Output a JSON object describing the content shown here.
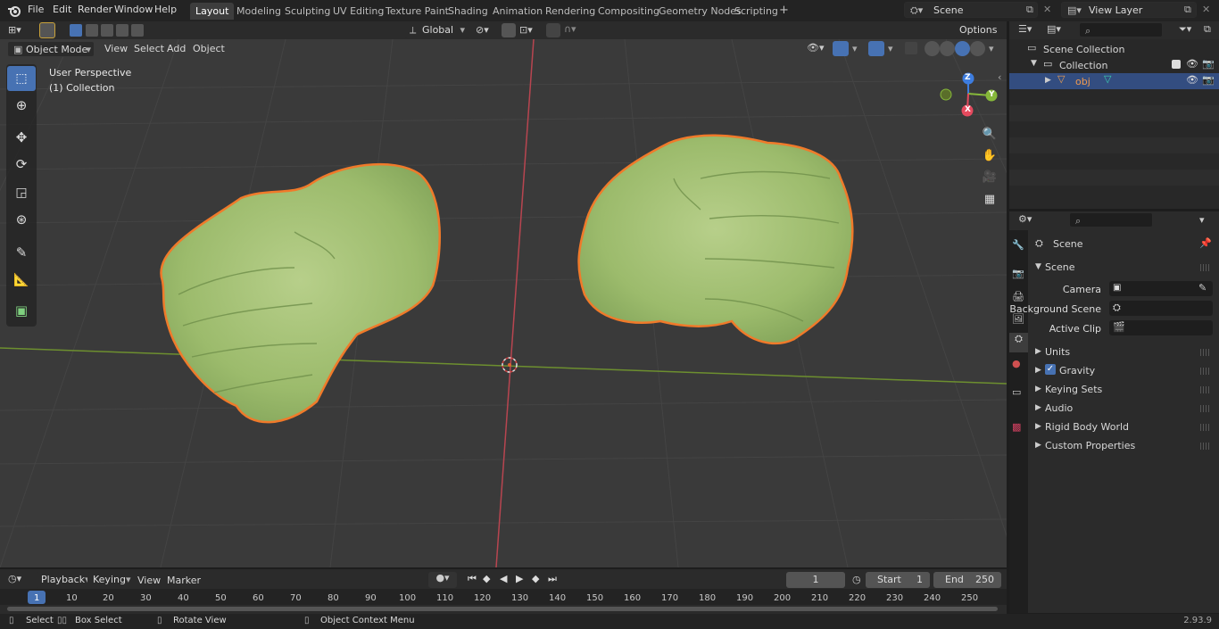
{
  "menus": [
    "File",
    "Edit",
    "Render",
    "Window",
    "Help"
  ],
  "workspaces": [
    "Layout",
    "Modeling",
    "Sculpting",
    "UV Editing",
    "Texture Paint",
    "Shading",
    "Animation",
    "Rendering",
    "Compositing",
    "Geometry Nodes",
    "Scripting"
  ],
  "active_workspace": "Layout",
  "add_workspace": "+",
  "scene_name": "Scene",
  "view_layer": "View Layer",
  "viewport_header": {
    "mode": "Object Mode",
    "menu": [
      "View",
      "Select",
      "Add",
      "Object"
    ],
    "transform_orientation": "Global",
    "options": "Options"
  },
  "viewport": {
    "perspective": "User Perspective",
    "collection_info": "(1) Collection"
  },
  "gizmo": {
    "z": "Z",
    "y": "Y",
    "x": "X"
  },
  "outliner": {
    "scene_collection": "Scene Collection",
    "collection": "Collection",
    "object": "obj"
  },
  "properties": {
    "header": "Scene",
    "panel": "Scene",
    "camera_label": "Camera",
    "background_scene_label": "Background Scene",
    "active_clip_label": "Active Clip",
    "subpanels": [
      "Units",
      "Gravity",
      "Keying Sets",
      "Audio",
      "Rigid Body World",
      "Custom Properties"
    ],
    "gravity_checked": true
  },
  "timeline": {
    "menus": [
      "Playback",
      "Keying",
      "View",
      "Marker"
    ],
    "current_frame": "1",
    "start_label": "Start",
    "start": "1",
    "end_label": "End",
    "end": "250",
    "ticks": [
      "1",
      "10",
      "20",
      "30",
      "40",
      "50",
      "60",
      "70",
      "80",
      "90",
      "100",
      "110",
      "120",
      "130",
      "140",
      "150",
      "160",
      "170",
      "180",
      "190",
      "200",
      "210",
      "220",
      "230",
      "240",
      "250"
    ]
  },
  "statusbar": {
    "select": "Select",
    "box_select": "Box Select",
    "rotate_view": "Rotate View",
    "context_menu": "Object Context Menu",
    "version": "2.93.9"
  },
  "colors": {
    "accent": "#4772b3",
    "selection_outline": "#f07a2a",
    "object_green": "#9cbf6e",
    "x_axis": "#e54a5e",
    "y_axis": "#86b83a",
    "z_axis": "#3d7de0"
  }
}
